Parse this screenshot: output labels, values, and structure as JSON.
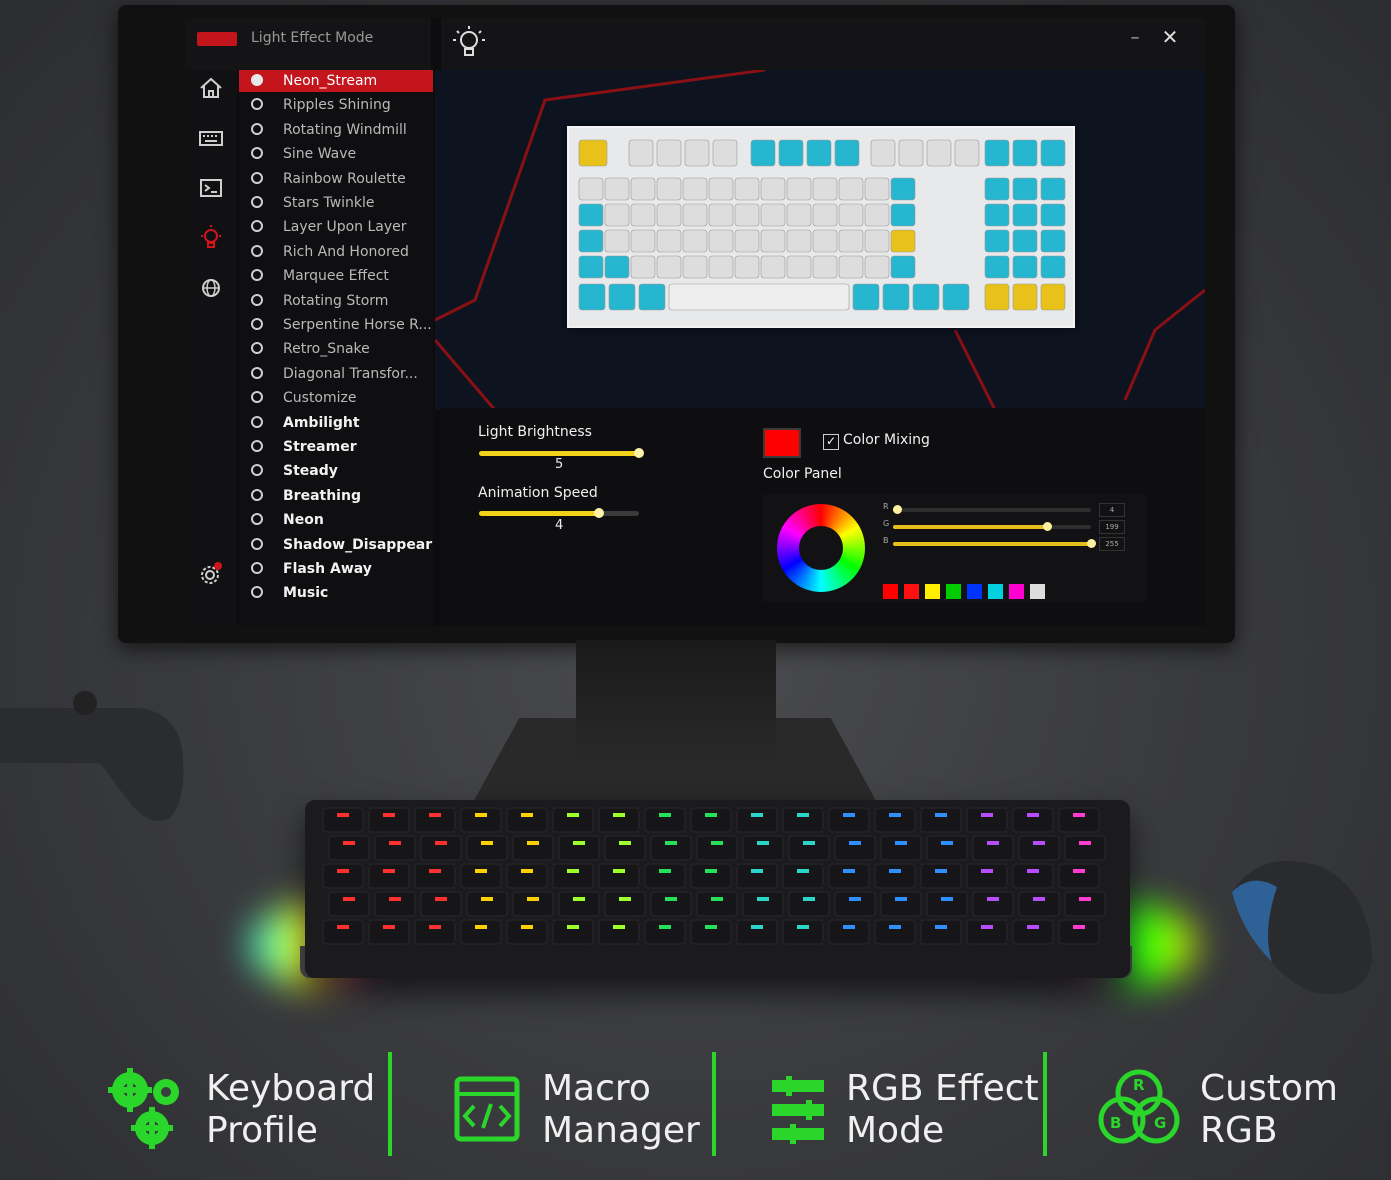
{
  "app": {
    "title": "Light Effect Mode",
    "minimize_label": "–",
    "close_label": "✕"
  },
  "effects": [
    {
      "label": "Neon_Stream",
      "selected": true,
      "bright": false
    },
    {
      "label": "Ripples Shining",
      "selected": false,
      "bright": false
    },
    {
      "label": "Rotating Windmill",
      "selected": false,
      "bright": false
    },
    {
      "label": "Sine Wave",
      "selected": false,
      "bright": false
    },
    {
      "label": "Rainbow Roulette",
      "selected": false,
      "bright": false
    },
    {
      "label": "Stars Twinkle",
      "selected": false,
      "bright": false
    },
    {
      "label": "Layer Upon Layer",
      "selected": false,
      "bright": false
    },
    {
      "label": "Rich And Honored",
      "selected": false,
      "bright": false
    },
    {
      "label": "Marquee Effect",
      "selected": false,
      "bright": false
    },
    {
      "label": "Rotating Storm",
      "selected": false,
      "bright": false
    },
    {
      "label": "Serpentine Horse R...",
      "selected": false,
      "bright": false
    },
    {
      "label": "Retro_Snake",
      "selected": false,
      "bright": false
    },
    {
      "label": "Diagonal Transfor...",
      "selected": false,
      "bright": false
    },
    {
      "label": "Customize",
      "selected": false,
      "bright": false
    },
    {
      "label": "Ambilight",
      "selected": false,
      "bright": true
    },
    {
      "label": "Streamer",
      "selected": false,
      "bright": true
    },
    {
      "label": "Steady",
      "selected": false,
      "bright": true
    },
    {
      "label": "Breathing",
      "selected": false,
      "bright": true
    },
    {
      "label": "Neon",
      "selected": false,
      "bright": true
    },
    {
      "label": "Shadow_Disappear",
      "selected": false,
      "bright": true
    },
    {
      "label": "Flash Away",
      "selected": false,
      "bright": true
    },
    {
      "label": "Music",
      "selected": false,
      "bright": true
    }
  ],
  "controls": {
    "brightness": {
      "label": "Light Brightness",
      "value": "5",
      "fraction": 1.0
    },
    "speed": {
      "label": "Animation Speed",
      "value": "4",
      "fraction": 0.75
    },
    "color_mixing": {
      "label": "Color Mixing",
      "checked": true
    },
    "color_panel_label": "Color Panel",
    "selected_color": "#ff0000",
    "rgb": [
      {
        "channel": "R",
        "value": "4",
        "fraction": 0.02
      },
      {
        "channel": "G",
        "value": "199",
        "fraction": 0.78
      },
      {
        "channel": "B",
        "value": "255",
        "fraction": 1.0
      }
    ],
    "presets": [
      "#ff0000",
      "#ff1010",
      "#ffee00",
      "#00cc00",
      "#0033ff",
      "#00d0e0",
      "#ff00d0",
      "#dddddd"
    ]
  },
  "features": [
    {
      "line1": "Keyboard",
      "line2": "Profile",
      "icon": "gears-icon"
    },
    {
      "line1": "Macro",
      "line2": "Manager",
      "icon": "code-window-icon"
    },
    {
      "line1": "RGB Effect",
      "line2": "Mode",
      "icon": "sliders-icon"
    },
    {
      "line1": "Custom",
      "line2": "RGB",
      "icon": "rgb-circles-icon"
    }
  ],
  "colors": {
    "accent": "#c4141c",
    "feature_green": "#2bd62b",
    "slider": "#f4d21a"
  }
}
